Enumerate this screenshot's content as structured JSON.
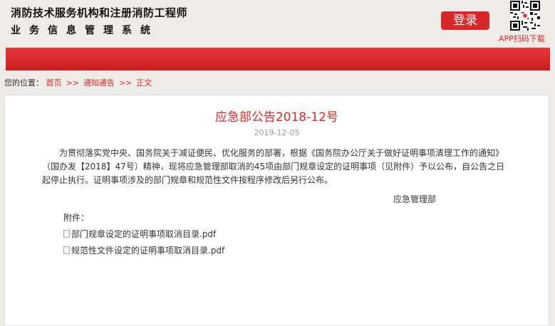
{
  "header": {
    "title_line1": "消防技术服务机构和注册消防工程师",
    "title_line2": "业务信息管理系统",
    "login_label": "登录",
    "app_download": "APP扫码下载"
  },
  "breadcrumb": {
    "label": "您的位置：",
    "items": [
      "首页",
      "通知通告",
      "正文"
    ],
    "separator": ">>"
  },
  "article": {
    "title": "应急部公告2018-12号",
    "date": "2019-12-05",
    "body": "为贯彻落实党中央、国务院关于减证便民、优化服务的部署，根据《国务院办公厅关于做好证明事项清理工作的通知》（国办发【2018】47号）精神，现将应急管理部取消的45项由部门规章设定的证明事项（见附件）予以公布，自公告之日起停止执行。证明事项涉及的部门规章和规范性文件按程序修改后另行公布。",
    "signature": "应急管理部",
    "attachments_label": "附件：",
    "attachments": [
      "部门规章设定的证明事项取消目录.pdf",
      "规范性文件设定的证明事项取消目录.pdf"
    ]
  },
  "colors": {
    "accent": "#d9272a",
    "background": "#efebe6"
  }
}
